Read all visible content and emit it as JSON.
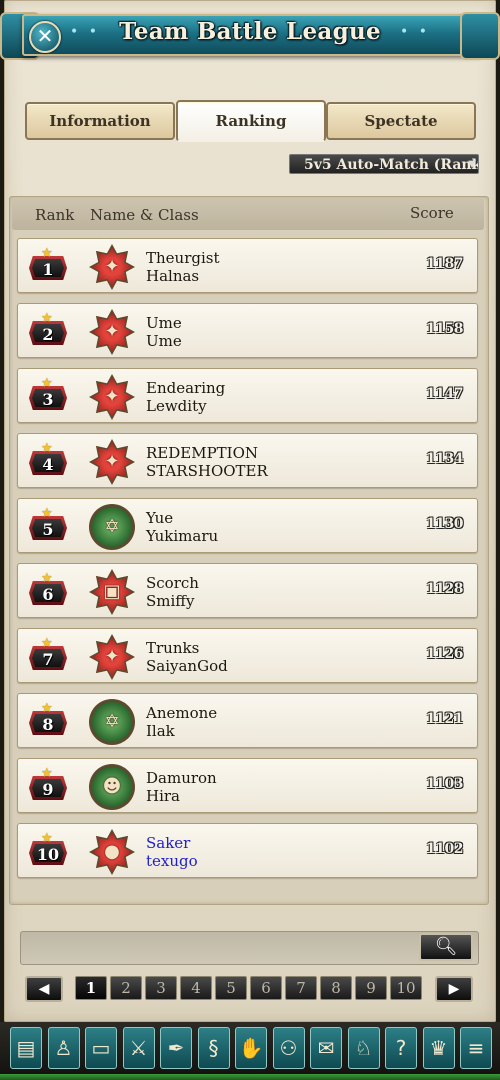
{
  "window": {
    "title": "Team Battle League"
  },
  "tabs": [
    {
      "label": "Information",
      "active": false
    },
    {
      "label": "Ranking",
      "active": true
    },
    {
      "label": "Spectate",
      "active": false
    }
  ],
  "match_filter": {
    "selected": "5v5 Auto-Match (Rank"
  },
  "table": {
    "headers": {
      "rank": "Rank",
      "name": "Name & Class",
      "score": "Score"
    },
    "rows": [
      {
        "rank": "1",
        "name": "Theurgist",
        "sub": "Halnas",
        "score": "1187",
        "class_icon": "red-star-icon"
      },
      {
        "rank": "2",
        "name": "Ume",
        "sub": "Ume",
        "score": "1158",
        "class_icon": "red-star-icon"
      },
      {
        "rank": "3",
        "name": "Endearing",
        "sub": "Lewdity",
        "score": "1147",
        "class_icon": "red-star-icon"
      },
      {
        "rank": "4",
        "name": "REDEMPTION",
        "sub": "STARSHOOTER",
        "score": "1134",
        "class_icon": "red-star-icon"
      },
      {
        "rank": "5",
        "name": "Yue",
        "sub": "Yukimaru",
        "score": "1130",
        "class_icon": "green-hexagram-icon"
      },
      {
        "rank": "6",
        "name": "Scorch",
        "sub": "Smiffy",
        "score": "1128",
        "class_icon": "red-cube-icon"
      },
      {
        "rank": "7",
        "name": "Trunks",
        "sub": "SaiyanGod",
        "score": "1126",
        "class_icon": "red-star-icon"
      },
      {
        "rank": "8",
        "name": "Anemone",
        "sub": "Ilak",
        "score": "1121",
        "class_icon": "green-hexagram-icon"
      },
      {
        "rank": "9",
        "name": "Damuron",
        "sub": "Hira",
        "score": "1103",
        "class_icon": "green-goblin-icon"
      },
      {
        "rank": "10",
        "name": "Saker",
        "sub": "texugo",
        "score": "1102",
        "class_icon": "red-bomb-icon",
        "highlight": true
      }
    ]
  },
  "search": {
    "value": ""
  },
  "pagination": {
    "pages": [
      "1",
      "2",
      "3",
      "4",
      "5",
      "6",
      "7",
      "8",
      "9",
      "10"
    ],
    "current": "1"
  },
  "toolbar": {
    "icons": [
      "chest-icon",
      "character-icon",
      "inventory-icon",
      "crossed-swords-icon",
      "quill-icon",
      "scroll-icon",
      "handshake-icon",
      "party-icon",
      "mail-icon",
      "pet-icon",
      "help-icon",
      "trophy-icon",
      "notes-icon"
    ]
  },
  "colors": {
    "banner": "#1c7084",
    "highlight_text": "#2121c9",
    "badge_red": "#c0393b"
  }
}
